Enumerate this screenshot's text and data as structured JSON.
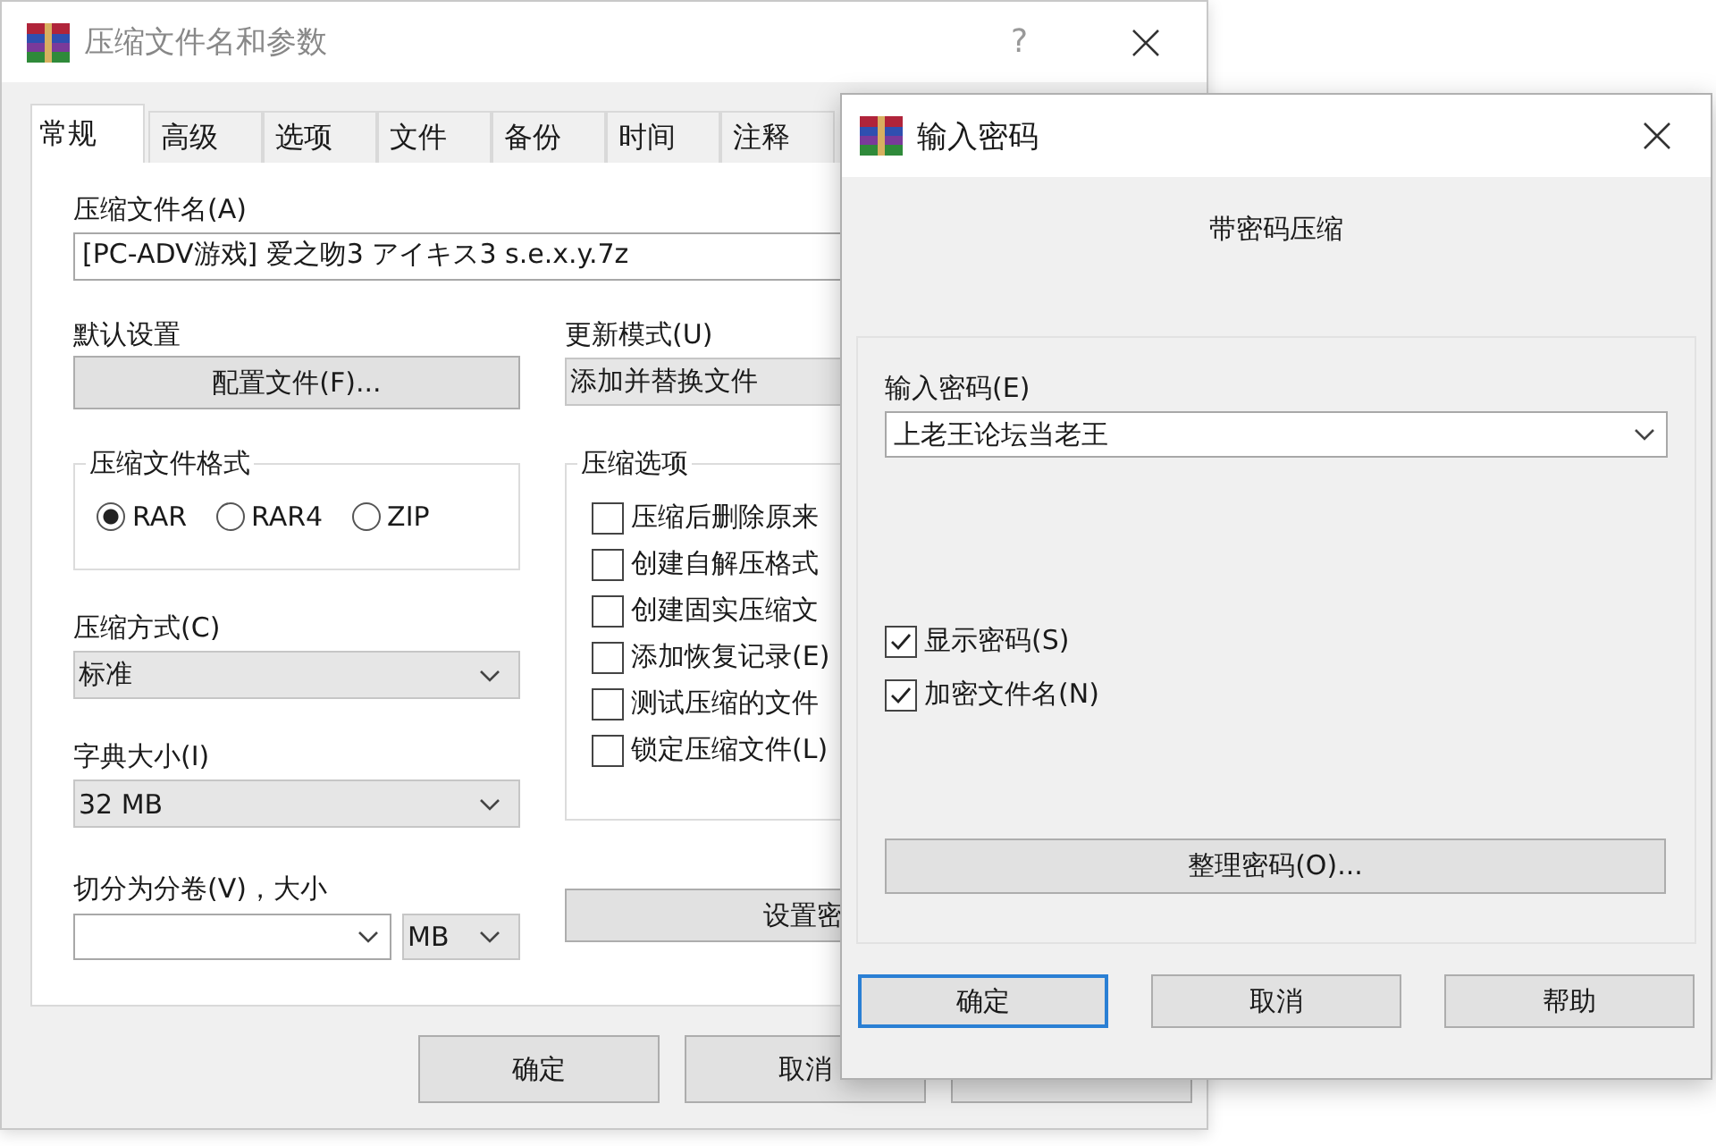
{
  "main_window": {
    "title": "压缩文件名和参数",
    "help_glyph": "?",
    "tabs": [
      {
        "label": "常规",
        "selected": true
      },
      {
        "label": "高级",
        "selected": false
      },
      {
        "label": "选项",
        "selected": false
      },
      {
        "label": "文件",
        "selected": false
      },
      {
        "label": "备份",
        "selected": false
      },
      {
        "label": "时间",
        "selected": false
      },
      {
        "label": "注释",
        "selected": false
      }
    ],
    "archive_name": {
      "label": "压缩文件名(A)",
      "value": "[PC-ADV游戏]  爱之吻3  アイキス3 s.e.x.y.7z"
    },
    "profiles": {
      "label": "默认设置",
      "button": "配置文件(F)..."
    },
    "update_mode": {
      "label": "更新模式(U)",
      "value": "添加并替换文件"
    },
    "archive_format": {
      "title": "压缩文件格式",
      "options": [
        {
          "label": "RAR",
          "selected": true
        },
        {
          "label": "RAR4",
          "selected": false
        },
        {
          "label": "ZIP",
          "selected": false
        }
      ]
    },
    "archive_options": {
      "title": "压缩选项",
      "items": [
        {
          "label": "压缩后删除原来",
          "checked": false
        },
        {
          "label": "创建自解压格式",
          "checked": false
        },
        {
          "label": "创建固实压缩文",
          "checked": false
        },
        {
          "label": "添加恢复记录(E)",
          "checked": false
        },
        {
          "label": "测试压缩的文件",
          "checked": false
        },
        {
          "label": "锁定压缩文件(L)",
          "checked": false
        }
      ]
    },
    "compression_method": {
      "label": "压缩方式(C)",
      "value": "标准"
    },
    "dictionary_size": {
      "label": "字典大小(I)",
      "value": "32 MB"
    },
    "split_volumes": {
      "label": "切分为分卷(V)，大小",
      "unit": "MB"
    },
    "set_password_button": "设置密",
    "buttons": [
      "确定",
      "取消"
    ]
  },
  "password_dialog": {
    "title": "输入密码",
    "heading": "带密码压缩",
    "password": {
      "label": "输入密码(E)",
      "value": "上老王论坛当老王"
    },
    "options": [
      {
        "label": "显示密码(S)",
        "checked": true
      },
      {
        "label": "加密文件名(N)",
        "checked": true
      }
    ],
    "organize_button": "整理密码(O)...",
    "buttons": [
      {
        "label": "确定",
        "default": true
      },
      {
        "label": "取消",
        "default": false
      },
      {
        "label": "帮助",
        "default": false
      }
    ]
  }
}
